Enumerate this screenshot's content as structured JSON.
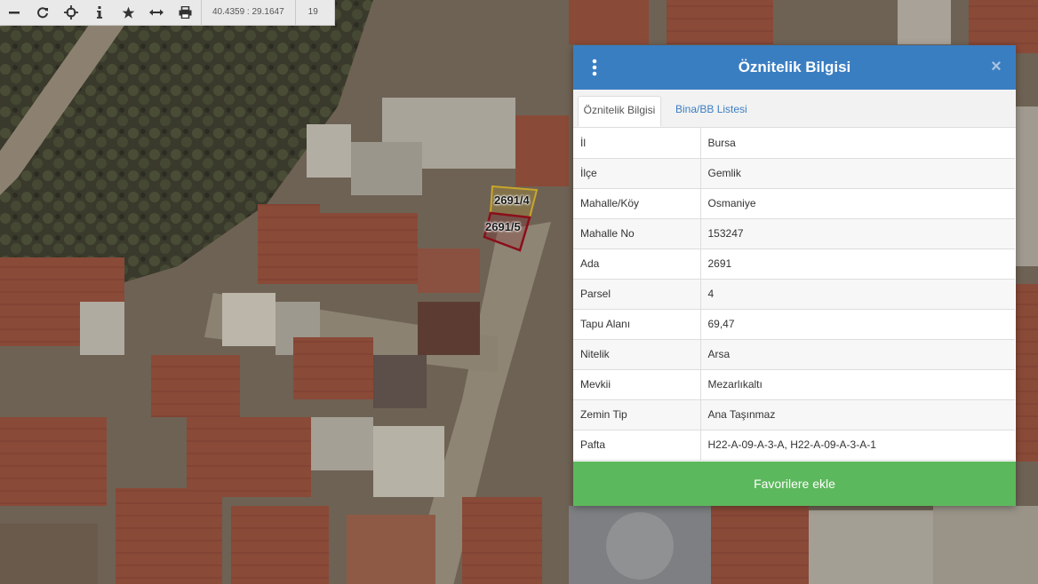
{
  "toolbar": {
    "buttons": [
      {
        "icon": "minus-icon"
      },
      {
        "icon": "refresh-icon"
      },
      {
        "icon": "crosshair-icon"
      },
      {
        "icon": "info-icon"
      },
      {
        "icon": "star-icon"
      },
      {
        "icon": "measure-icon"
      },
      {
        "icon": "print-icon"
      }
    ],
    "coordinates": "40.4359 : 29.1647",
    "zoom": "19"
  },
  "map": {
    "parcels": [
      {
        "label": "2691/4",
        "color": "#c9a62a"
      },
      {
        "label": "2691/5",
        "color": "#8b0e1a"
      }
    ]
  },
  "panel": {
    "title": "Öznitelik Bilgisi",
    "close_symbol": "×",
    "tabs": [
      {
        "label": "Öznitelik Bilgisi",
        "active": true
      },
      {
        "label": "Bina/BB Listesi",
        "active": false
      }
    ],
    "rows": [
      {
        "key": "İl",
        "value": "Bursa"
      },
      {
        "key": "İlçe",
        "value": "Gemlik"
      },
      {
        "key": "Mahalle/Köy",
        "value": "Osmaniye"
      },
      {
        "key": "Mahalle No",
        "value": "153247"
      },
      {
        "key": "Ada",
        "value": "2691"
      },
      {
        "key": "Parsel",
        "value": "4"
      },
      {
        "key": "Tapu Alanı",
        "value": "69,47"
      },
      {
        "key": "Nitelik",
        "value": "Arsa"
      },
      {
        "key": "Mevkii",
        "value": "Mezarlıkaltı"
      },
      {
        "key": "Zemin Tip",
        "value": "Ana Taşınmaz"
      },
      {
        "key": "Pafta",
        "value": "H22-A-09-A-3-A, H22-A-09-A-3-A-1"
      }
    ],
    "favorite_button": "Favorilere ekle",
    "colors": {
      "header": "#3a7ec2",
      "favorite": "#5cb85c"
    }
  }
}
